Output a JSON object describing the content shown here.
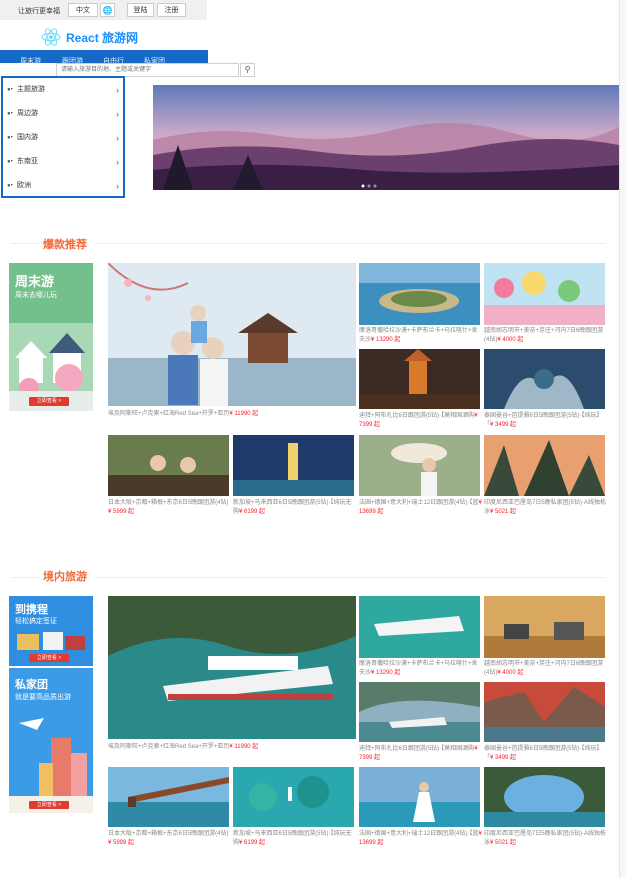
{
  "header": {
    "slogan": "让旅行更幸福",
    "language": "中文",
    "globe_icon": "globe-icon",
    "login": "登陆",
    "register": "注册",
    "logo_text": "React 旅游网"
  },
  "nav": {
    "items": [
      "周末游",
      "跟团游",
      "自由行",
      "私家团"
    ],
    "search_placeholder": "请输入旅游目的地、主题或关键字"
  },
  "side_menu": {
    "items": [
      "主题旅游",
      "周边游",
      "国内游",
      "东南亚",
      "欧洲"
    ]
  },
  "sections": [
    {
      "title": "爆款推荐",
      "ad": {
        "title": "周末游",
        "subtitle": "周末去哪儿玩",
        "button": "立即查看 >"
      },
      "products": [
        {
          "text": "埃及阿斯旺+卢克索+红海Red Sea+开罗+亚历",
          "price": "¥ 11990 起"
        },
        {
          "text": "摩洛哥撒哈拉沙漠+卡萨布兰卡+马拉喀什+舍夫沙",
          "price": "¥ 13290 起"
        },
        {
          "text": "越南胡志明市+美奈+芽庄+河内7日6晚跟团游(4钻)",
          "price": "¥ 4000 起"
        },
        {
          "text": "迪拜+阿布扎比6日跟团游(5钻)·【莫相国酒购",
          "price": "¥ 7399 起"
        },
        {
          "text": "泰国曼谷+芭提雅6日5晚跟团游(5钻)·【纯玩】「",
          "price": "¥ 3499 起"
        },
        {
          "text": "日本大阪+京都+箱根+东京6日5晚跟团游(4钻)",
          "price": "¥ 5999 起"
        },
        {
          "text": "新加坡+马来西亚6日5晚跟团游(5钻)·【纯玩无购",
          "price": "¥ 6199 起"
        },
        {
          "text": "法国+德国+意大利+瑞士12日跟团游(4钻)·【蓝",
          "price": "¥ 13699 起"
        },
        {
          "text": "印度尼西亚巴厘岛7日5晚私家团(5钻)·A线独栋泳",
          "price": "¥ 5021 起"
        }
      ]
    },
    {
      "title": "境内旅游",
      "ad1": {
        "title": "到携程",
        "subtitle": "轻松搞定签证",
        "button": "立即查看 >"
      },
      "ad2": {
        "title": "私家团",
        "subtitle": "就是要高品质出游",
        "button": "立即查看 >"
      },
      "products": [
        {
          "text": "埃及阿斯旺+卢克索+红海Red Sea+开罗+亚历",
          "price": "¥ 11990 起"
        },
        {
          "text": "摩洛哥撒哈拉沙漠+卡萨布兰卡+马拉喀什+舍夫沙",
          "price": "¥ 13290 起"
        },
        {
          "text": "越南胡志明市+美奈+芽庄+河内7日6晚跟团游(4钻)",
          "price": "¥ 4000 起"
        },
        {
          "text": "迪拜+阿布扎比6日跟团游(5钻)·【莫相国酒购",
          "price": "¥ 7399 起"
        },
        {
          "text": "泰国曼谷+芭提雅6日5晚跟团游(5钻)·【纯玩】「",
          "price": "¥ 3499 起"
        },
        {
          "text": "日本大阪+京都+箱根+东京6日5晚跟团游(4钻)",
          "price": "¥ 5999 起"
        },
        {
          "text": "新加坡+马来西亚6日5晚跟团游(5钻)·【纯玩无购",
          "price": "¥ 6199 起"
        },
        {
          "text": "法国+德国+意大利+瑞士12日跟团游(4钻)·【蓝",
          "price": "¥ 13699 起"
        },
        {
          "text": "印度尼西亚巴厘岛7日5晚私家团(5钻)·A线独栋泳",
          "price": "¥ 5021 起"
        }
      ]
    }
  ],
  "colors": {
    "brand": "#1769c7",
    "accent": "#f26c3b",
    "price": "#f5222d",
    "logo": "#1890ff"
  }
}
